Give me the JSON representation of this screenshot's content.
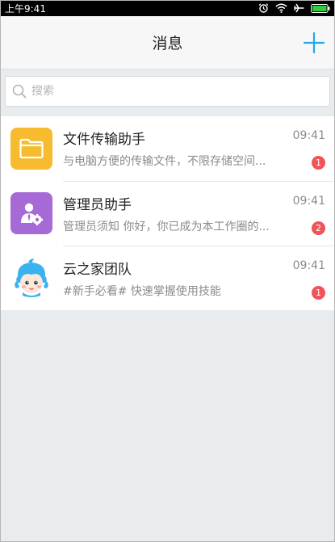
{
  "statusbar": {
    "time": "上午9:41",
    "icons": [
      "alarm-icon",
      "wifi-icon",
      "airplane-icon",
      "battery-icon"
    ]
  },
  "header": {
    "title": "消息",
    "add_icon": "plus-icon",
    "accent_color": "#23a9e8"
  },
  "search": {
    "placeholder": "搜索",
    "value": ""
  },
  "conversations": [
    {
      "name": "文件传输助手",
      "time": "09:41",
      "preview": "与电脑方便的传输文件，不限存储空间...",
      "unread": "1",
      "avatar_icon": "folder-icon",
      "avatar_color": "#f7bb2f"
    },
    {
      "name": "管理员助手",
      "time": "09:41",
      "preview": "管理员须知 你好，你已成为本工作圈的...",
      "unread": "2",
      "avatar_icon": "admin-gear-icon",
      "avatar_color": "#a56ad6"
    },
    {
      "name": "云之家团队",
      "time": "09:41",
      "preview": "#新手必看# 快速掌握使用技能",
      "unread": "1",
      "avatar_icon": "mascot-icon",
      "avatar_color": "#3ab2f0"
    }
  ]
}
